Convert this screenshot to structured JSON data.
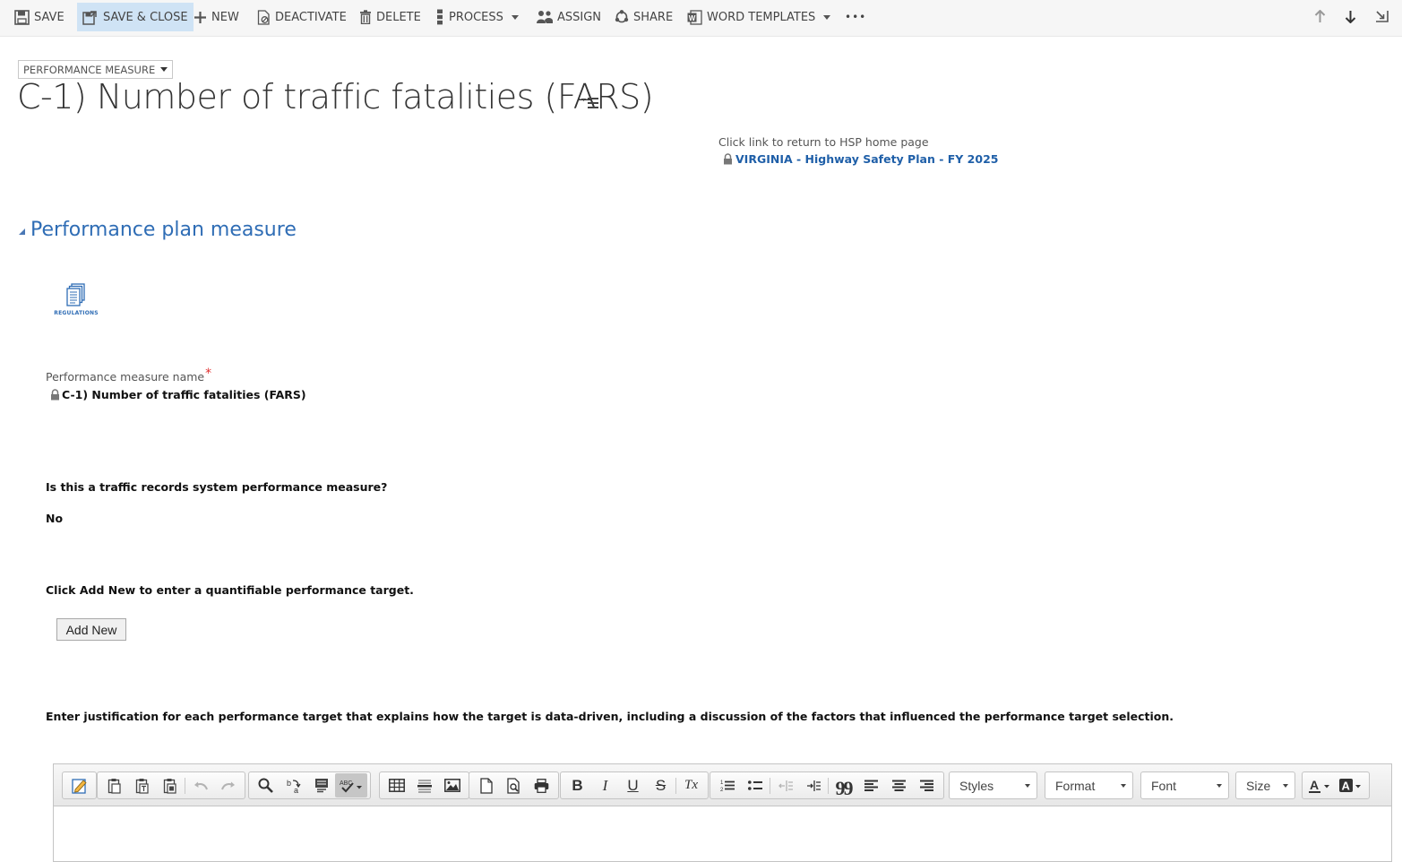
{
  "toolbar": {
    "save": "SAVE",
    "save_close": "SAVE & CLOSE",
    "new": "NEW",
    "deactivate": "DEACTIVATE",
    "delete": "DELETE",
    "process": "PROCESS",
    "assign": "ASSIGN",
    "share": "SHARE",
    "word_templates": "WORD TEMPLATES",
    "more": "•••"
  },
  "header": {
    "entity_type": "PERFORMANCE MEASURE",
    "title": "C-1) Number of traffic fatalities (FARS)",
    "home_hint": "Click link to return to HSP home page",
    "home_link": "VIRGINIA - Highway Safety Plan - FY 2025"
  },
  "section": {
    "title": "Performance plan measure",
    "regulations_label": "REGULATIONS",
    "name_label": "Performance measure name",
    "required_mark": "*",
    "name_value": "C-1) Number of traffic fatalities (FARS)",
    "traffic_question": "Is this a traffic records system performance measure?",
    "traffic_answer": "No",
    "target_prompt": "Click Add New to enter a quantifiable performance target.",
    "add_new": "Add New",
    "justification_prompt": "Enter justification for each performance target that explains how the target is data-driven, including a discussion of the factors that influenced the performance target selection."
  },
  "editor": {
    "styles": "Styles",
    "format": "Format",
    "font": "Font",
    "size": "Size",
    "bold": "B",
    "italic": "I",
    "underline": "U",
    "strike": "S",
    "remove_format": "Tx",
    "blockquote": "99"
  },
  "colors": {
    "accent": "#2f6db5",
    "link": "#1f5fa8",
    "toolbar_bg": "#f6f6f6",
    "active_bg": "#cfe3f5",
    "required": "#e03030"
  }
}
